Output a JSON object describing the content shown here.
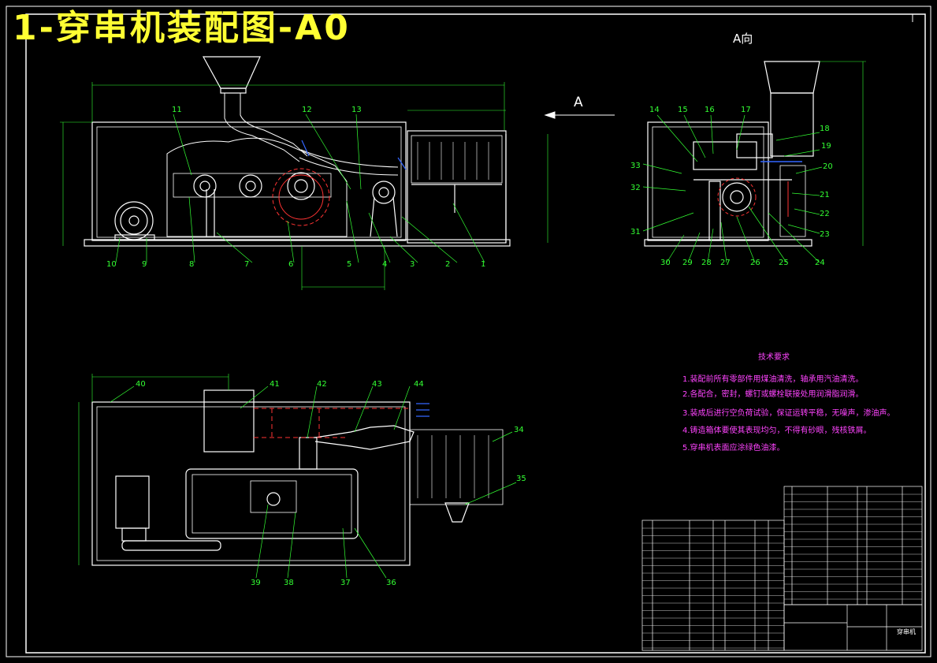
{
  "title": "1-穿串机装配图-A0",
  "view_a_label": "A向",
  "arrow_a_label": "A",
  "part_numbers": {
    "front_view": [
      "1",
      "2",
      "3",
      "4",
      "5",
      "6",
      "7",
      "8",
      "9",
      "10",
      "11",
      "12",
      "13"
    ],
    "side_view": [
      "14",
      "15",
      "16",
      "17",
      "18",
      "19",
      "20",
      "21",
      "22",
      "23",
      "24",
      "25",
      "26",
      "27",
      "28",
      "29",
      "30",
      "31",
      "32",
      "33"
    ],
    "top_view": [
      "34",
      "35",
      "36",
      "37",
      "38",
      "39",
      "40",
      "41",
      "42",
      "43",
      "44"
    ]
  },
  "technical_requirements": {
    "heading": "技术要求",
    "items": [
      "1.装配前所有零部件用煤油清洗，轴承用汽油清洗。",
      "2.各配合，密封，螺钉或螺栓联接处用润滑脂润滑。",
      "3.装成后进行空负荷试验，保证运转平稳，无噪声，渗油声。",
      "4.铸造箱体要使其表现均匀，不得有砂眼，残核铁屑。",
      "5.穿串机表面应涂绿色油漆。"
    ]
  },
  "title_block": {
    "drawing_name": "穿串机"
  },
  "colors": {
    "background": "#000000",
    "outline": "#ffffff",
    "leader": "#33ff33",
    "dimension": "#33ff33",
    "section": "#ff3333",
    "hidden": "#3366ff",
    "title": "#ffff33",
    "notes": "#ff44ff"
  }
}
